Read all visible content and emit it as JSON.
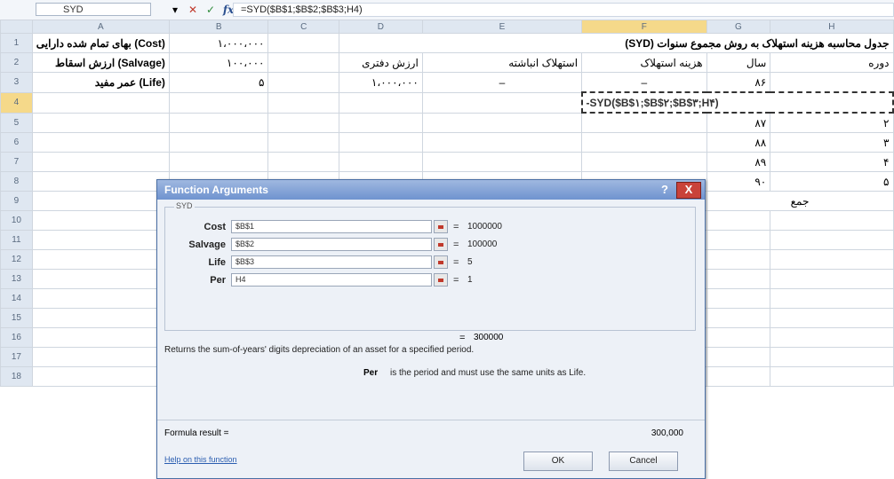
{
  "formula_bar": {
    "name_box": "SYD",
    "formula": "=SYD($B$1;$B$2;$B$3;H4)"
  },
  "columns": [
    "",
    "A",
    "B",
    "C",
    "D",
    "E",
    "F",
    "G",
    "H"
  ],
  "rows": [
    {
      "n": "1",
      "A": "(Cost) بهای تمام شده دارایی",
      "B": "۱،۰۰۰،۰۰۰",
      "C": "",
      "D": "جدول محاسبه هزینه استهلاک به روش مجموع سنوات (SYD)",
      "E": "",
      "F": "",
      "G": "",
      "H": ""
    },
    {
      "n": "2",
      "A": "(Salvage) ارزش اسقاط",
      "B": "۱۰۰،۰۰۰",
      "C": "",
      "D": "ارزش دفتری",
      "E": "استهلاک انباشته",
      "F": "هزینه استهلاک",
      "G": "سال",
      "H": "دوره"
    },
    {
      "n": "3",
      "A": "(Life) عمر مفید",
      "B": "۵",
      "C": "",
      "D": "۱،۰۰۰،۰۰۰",
      "E": "–",
      "F": "–",
      "G": "۸۶",
      "H": ""
    },
    {
      "n": "4",
      "A": "",
      "B": "",
      "C": "",
      "D": "",
      "E": "",
      "F": "-SYD($B$۱;$B$۲;$B$۳;H۴)",
      "G": "",
      "H": ""
    },
    {
      "n": "5",
      "A": "",
      "B": "",
      "C": "",
      "D": "",
      "E": "",
      "F": "",
      "G": "۸۷",
      "H": "۲"
    },
    {
      "n": "6",
      "A": "",
      "B": "",
      "C": "",
      "D": "",
      "E": "",
      "F": "",
      "G": "۸۸",
      "H": "۳"
    },
    {
      "n": "7",
      "A": "",
      "B": "",
      "C": "",
      "D": "",
      "E": "",
      "F": "",
      "G": "۸۹",
      "H": "۴"
    },
    {
      "n": "8",
      "A": "",
      "B": "",
      "C": "",
      "D": "",
      "E": "",
      "F": "",
      "G": "۹۰",
      "H": "۵"
    },
    {
      "n": "9",
      "A": "",
      "B": "",
      "C": "",
      "D": "",
      "E": "",
      "F": "",
      "G": "جمع",
      "H": ""
    },
    {
      "n": "10"
    },
    {
      "n": "11"
    },
    {
      "n": "12"
    },
    {
      "n": "13"
    },
    {
      "n": "14"
    },
    {
      "n": "15"
    },
    {
      "n": "16"
    },
    {
      "n": "17"
    },
    {
      "n": "18"
    }
  ],
  "dialog": {
    "title": "Function Arguments",
    "help_glyph": "?",
    "close_glyph": "X",
    "group_label": "SYD",
    "args": [
      {
        "label": "Cost",
        "input": "$B$1",
        "value": "1000000"
      },
      {
        "label": "Salvage",
        "input": "$B$2",
        "value": "100000"
      },
      {
        "label": "Life",
        "input": "$B$3",
        "value": "5"
      },
      {
        "label": "Per",
        "input": "H4",
        "value": "1"
      }
    ],
    "eq": "=",
    "result_value": "300000",
    "description": "Returns the sum-of-years' digits depreciation of an asset for a specified period.",
    "arg_desc_name": "Per",
    "arg_desc": "is the period and must use the same units as Life.",
    "formula_result_label": "Formula result =",
    "formula_result_value": "300,000",
    "help_link": "Help on this function",
    "ok_label": "OK",
    "cancel_label": "Cancel"
  }
}
